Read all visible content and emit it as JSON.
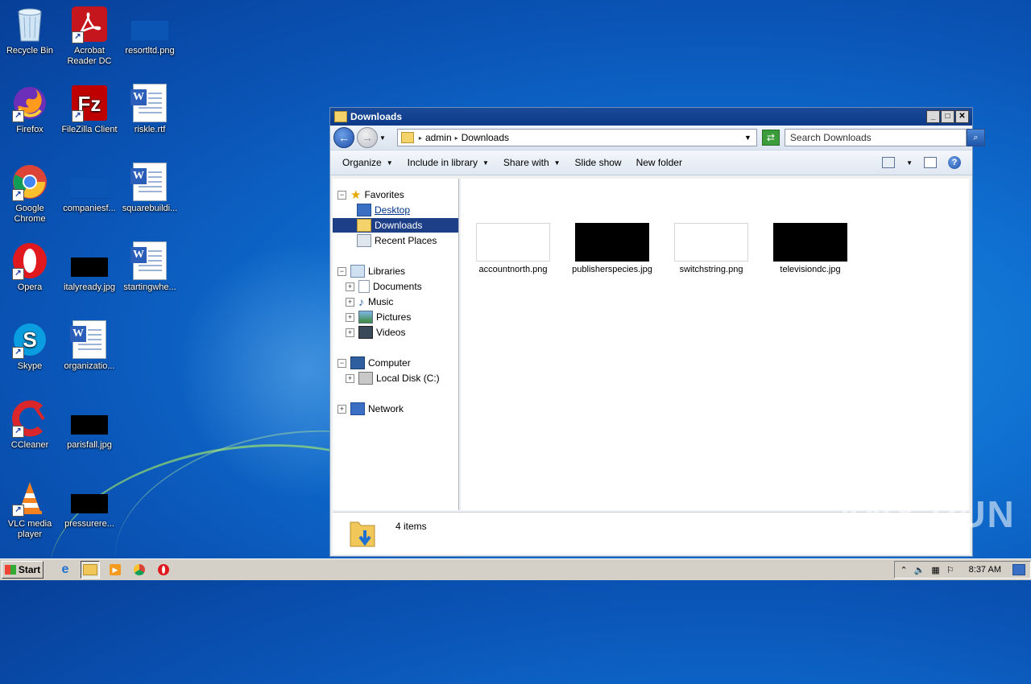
{
  "desktop": {
    "icons": [
      {
        "label": "Recycle Bin"
      },
      {
        "label": "Acrobat Reader DC"
      },
      {
        "label": "resortltd.png"
      },
      {
        "label": "Firefox"
      },
      {
        "label": "FileZilla Client"
      },
      {
        "label": "riskle.rtf"
      },
      {
        "label": "Google Chrome"
      },
      {
        "label": "companiesf..."
      },
      {
        "label": "squarebuildi..."
      },
      {
        "label": "Opera"
      },
      {
        "label": "italyready.jpg"
      },
      {
        "label": "startingwhe..."
      },
      {
        "label": "Skype"
      },
      {
        "label": "organizatio..."
      },
      {
        "label": "CCleaner"
      },
      {
        "label": "parisfall.jpg"
      },
      {
        "label": "VLC media player"
      },
      {
        "label": "pressurere..."
      }
    ]
  },
  "window": {
    "title": "Downloads",
    "address": {
      "crumbs": [
        "admin",
        "Downloads"
      ]
    },
    "search": {
      "placeholder": "Search Downloads"
    },
    "toolbar": {
      "organize": "Organize",
      "include": "Include in library",
      "share": "Share with",
      "slideshow": "Slide show",
      "newfolder": "New folder"
    },
    "nav": {
      "favorites": "Favorites",
      "desktop": "Desktop",
      "downloads": "Downloads",
      "recent": "Recent Places",
      "libraries": "Libraries",
      "documents": "Documents",
      "music": "Music",
      "pictures": "Pictures",
      "videos": "Videos",
      "computer": "Computer",
      "localdisk": "Local Disk (C:)",
      "network": "Network"
    },
    "files": [
      {
        "name": "accountnorth.png",
        "thumb": "white"
      },
      {
        "name": "publisherspecies.jpg",
        "thumb": "black"
      },
      {
        "name": "switchstring.png",
        "thumb": "white"
      },
      {
        "name": "televisiondc.jpg",
        "thumb": "black"
      }
    ],
    "status": {
      "count": "4 items"
    }
  },
  "taskbar": {
    "start": "Start",
    "clock": "8:37 AM"
  },
  "watermark": "ANY RUN"
}
